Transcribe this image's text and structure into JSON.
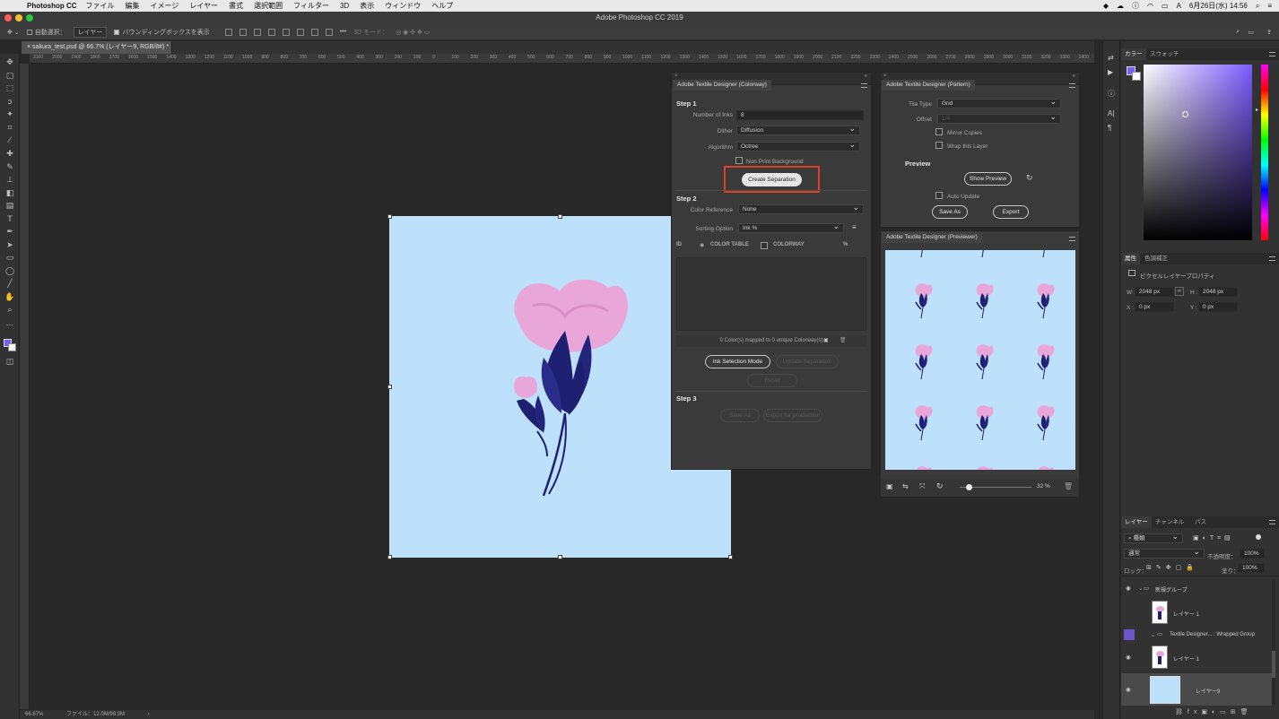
{
  "menubar": {
    "app_name": "Photoshop CC",
    "items": [
      "ファイル",
      "編集",
      "イメージ",
      "レイヤー",
      "書式",
      "選択範囲",
      "フィルター",
      "3D",
      "表示",
      "ウィンドウ",
      "ヘルプ"
    ],
    "clock": "6月26日(水) 14:56",
    "lang": "A"
  },
  "window": {
    "title": "Adobe Photoshop CC 2019"
  },
  "options": {
    "auto_select_label": "自動選択：",
    "auto_select_value": "レイヤー",
    "bounding_box_label": "バウンディングボックスを表示",
    "mode_3d": "3D モード："
  },
  "document": {
    "tab_label": "sakura_test.psd @ 66.7% (レイヤー9, RGB/8#) *",
    "zoom": "66.67%",
    "file_info": "ファイル：12.0M/98.0M",
    "ruler_ticks": [
      "2100",
      "2000",
      "1900",
      "1800",
      "1700",
      "1600",
      "1500",
      "1400",
      "1300",
      "1200",
      "1100",
      "1000",
      "900",
      "800",
      "700",
      "600",
      "500",
      "400",
      "300",
      "200",
      "100",
      "0",
      "100",
      "200",
      "300",
      "400",
      "500",
      "600",
      "700",
      "800",
      "900",
      "1000",
      "1100",
      "1200",
      "1300",
      "1400",
      "1500",
      "1600",
      "1700",
      "1800",
      "1900",
      "2000",
      "2100",
      "2200",
      "2300",
      "2400",
      "2500",
      "2600",
      "2700",
      "2800",
      "2900",
      "3000",
      "3100",
      "3200",
      "3300",
      "3400"
    ]
  },
  "colorway_panel": {
    "title": "Adobe Textile Designer (Colorway)",
    "step1": "Step 1",
    "num_inks_label": "Number of Inks",
    "num_inks_value": "8",
    "dither_label": "Dither",
    "dither_value": "Diffusion",
    "algorithm_label": "Algorithm",
    "algorithm_value": "Octree",
    "non_print_bg": "Non Print Background",
    "create_separation": "Create Separation",
    "step2": "Step 2",
    "color_reference_label": "Color Reference",
    "color_reference_value": "None",
    "sorting_option_label": "Sorting Option",
    "sorting_option_value": "Ink %",
    "col_id": "ID",
    "col_color_table": "COLOR TABLE",
    "col_colorway": "COLORWAY",
    "col_pct": "%",
    "mapping_status": "0 Color(s) mapped to 0 unique Colorway(s)",
    "ink_selection_mode": "Ink Selection Mode",
    "update_separation": "Update Separation",
    "reset": "Reset",
    "step3": "Step 3",
    "save_as": "Save As",
    "export_production": "Export for production"
  },
  "pattern_panel": {
    "title": "Adobe Textile Designer (Pattern)",
    "tile_type_label": "Tile Type",
    "tile_type_value": "Grid",
    "offset_label": "Offset",
    "offset_value": "1/4",
    "mirror_copies": "Mirror Copies",
    "wrap_layer": "Wrap this Layer",
    "preview_heading": "Preview",
    "show_preview": "Show Preview",
    "auto_update": "Auto Update",
    "save_as": "Save As",
    "export": "Export"
  },
  "previewer_panel": {
    "title": "Adobe Textile Designer (Previewer)",
    "zoom_value": "32 %",
    "zoom_fraction": 0.12
  },
  "color_panel": {
    "tab_color": "カラー",
    "tab_swatches": "スウォッチ",
    "hue_color": "#7a5cff"
  },
  "properties_panel": {
    "tab_properties": "属性",
    "tab_adjust": "色調補正",
    "subtitle": "ピクセルレイヤープロパティ",
    "w_label": "W :",
    "w_value": "2048 px",
    "h_label": "H :",
    "h_value": "2048 px",
    "x_label": "X :",
    "x_value": "0 px",
    "y_label": "Y :",
    "y_value": "0 px"
  },
  "layers_panel": {
    "tab_layers": "レイヤー",
    "tab_channels": "チャンネル",
    "tab_paths": "パス",
    "filter_kind": "種類",
    "blend_mode": "通常",
    "opacity_label": "不透明度：",
    "opacity_value": "100%",
    "lock_label": "ロック：",
    "fill_label": "塗り：",
    "fill_value": "100%",
    "layers": [
      {
        "name": "新規グループ",
        "type": "group"
      },
      {
        "name": "レイヤー 1",
        "type": "pixel"
      },
      {
        "name": "Textile Designer... : Wrapped Group",
        "type": "group"
      },
      {
        "name": "レイヤー 1",
        "type": "pixel"
      },
      {
        "name": "レイヤー9",
        "type": "fill"
      }
    ]
  },
  "colors": {
    "canvas_bg": "#bde0fb",
    "petal_pink": "#e9a6d8",
    "leaf_navy": "#1d2070",
    "highlight_red": "#e0402a"
  }
}
